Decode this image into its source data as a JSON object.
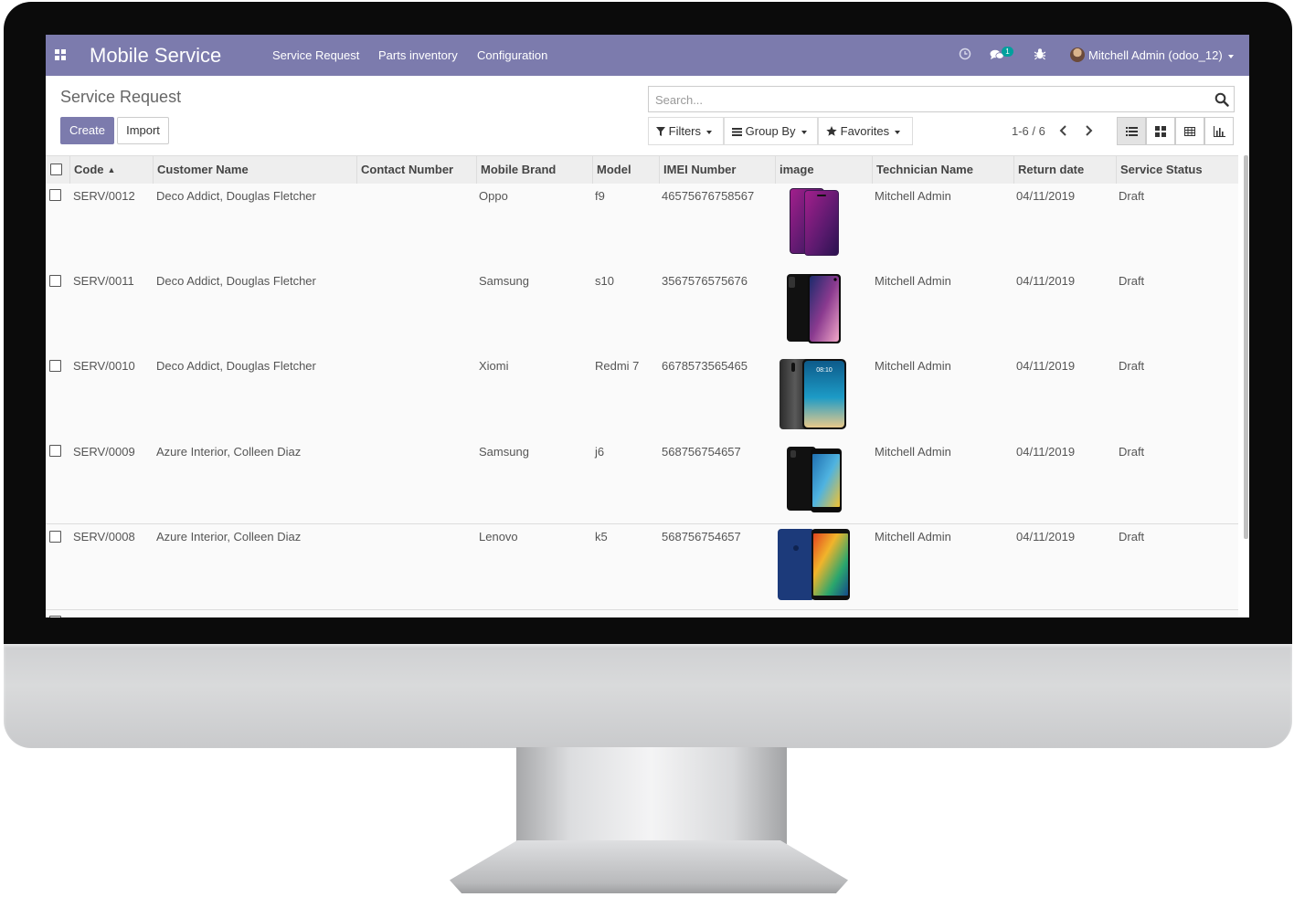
{
  "nav": {
    "app_title": "Mobile Service",
    "menu": [
      "Service Request",
      "Parts inventory",
      "Configuration"
    ],
    "message_count": "1",
    "user": "Mitchell Admin (odoo_12)"
  },
  "control_panel": {
    "title": "Service Request",
    "create_label": "Create",
    "import_label": "Import",
    "search_placeholder": "Search...",
    "filters_label": "Filters",
    "group_by_label": "Group By",
    "favorites_label": "Favorites",
    "pager": "1-6 / 6"
  },
  "table": {
    "columns": [
      "Code",
      "Customer Name",
      "Contact Number",
      "Mobile Brand",
      "Model",
      "IMEI Number",
      "image",
      "Technician Name",
      "Return date",
      "Service Status"
    ],
    "rows": [
      {
        "code": "SERV/0012",
        "customer": "Deco Addict, Douglas Fletcher",
        "contact": "",
        "brand": "Oppo",
        "model": "f9",
        "imei": "46575676758567",
        "image": "oppo-f9-phone",
        "technician": "Mitchell Admin",
        "return_date": "04/11/2019",
        "status": "Draft"
      },
      {
        "code": "SERV/0011",
        "customer": "Deco Addict, Douglas Fletcher",
        "contact": "",
        "brand": "Samsung",
        "model": "s10",
        "imei": "3567576575676",
        "image": "samsung-s10-phone",
        "technician": "Mitchell Admin",
        "return_date": "04/11/2019",
        "status": "Draft"
      },
      {
        "code": "SERV/0010",
        "customer": "Deco Addict, Douglas Fletcher",
        "contact": "",
        "brand": "Xiomi",
        "model": "Redmi 7",
        "imei": "6678573565465",
        "image": "redmi-7-phone",
        "technician": "Mitchell Admin",
        "return_date": "04/11/2019",
        "status": "Draft",
        "image_clock": "08:10"
      },
      {
        "code": "SERV/0009",
        "customer": "Azure Interior, Colleen Diaz",
        "contact": "",
        "brand": "Samsung",
        "model": "j6",
        "imei": "568756754657",
        "image": "samsung-j6-phone",
        "technician": "Mitchell Admin",
        "return_date": "04/11/2019",
        "status": "Draft"
      },
      {
        "code": "SERV/0008",
        "customer": "Azure Interior, Colleen Diaz",
        "contact": "",
        "brand": "Lenovo",
        "model": "k5",
        "imei": "568756754657",
        "image": "lenovo-k5-phone",
        "technician": "Mitchell Admin",
        "return_date": "04/11/2019",
        "status": "Draft"
      }
    ]
  },
  "colors": {
    "navbar": "#7c7bad",
    "primary_button": "#7c7bad",
    "badge": "#00a09d"
  }
}
